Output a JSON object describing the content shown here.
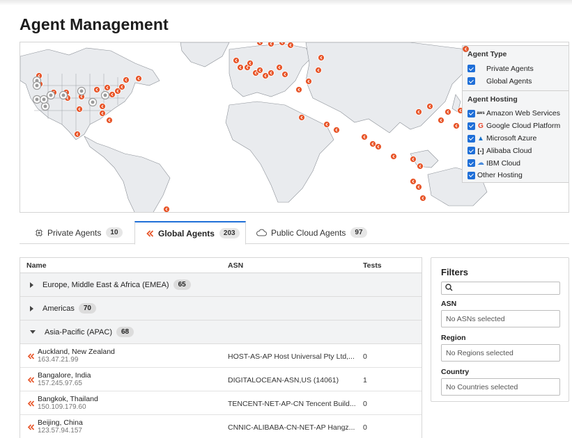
{
  "page": {
    "title": "Agent Management"
  },
  "legend": {
    "agent_type_title": "Agent Type",
    "agent_types": [
      {
        "label": "Private Agents",
        "icon": "private-agent-icon",
        "checked": true
      },
      {
        "label": "Global Agents",
        "icon": "global-agent-icon",
        "checked": true
      }
    ],
    "agent_hosting_title": "Agent Hosting",
    "hosting": [
      {
        "label": "Amazon Web Services",
        "icon": "aws-icon",
        "checked": true
      },
      {
        "label": "Google Cloud Platform",
        "icon": "google-icon",
        "checked": true
      },
      {
        "label": "Microsoft Azure",
        "icon": "azure-icon",
        "checked": true
      },
      {
        "label": "Alibaba Cloud",
        "icon": "alibaba-icon",
        "checked": true
      },
      {
        "label": "IBM Cloud",
        "icon": "ibm-cloud-icon",
        "checked": true
      },
      {
        "label": "Other Hosting",
        "icon": "",
        "checked": true
      }
    ]
  },
  "tabs": [
    {
      "label": "Private Agents",
      "count": "10",
      "active": false
    },
    {
      "label": "Global Agents",
      "count": "203",
      "active": true
    },
    {
      "label": "Public Cloud Agents",
      "count": "97",
      "active": false
    }
  ],
  "table": {
    "headers": {
      "name": "Name",
      "asn": "ASN",
      "tests": "Tests"
    },
    "groups": [
      {
        "label": "Europe, Middle East & Africa (EMEA)",
        "count": "65",
        "expanded": false
      },
      {
        "label": "Americas",
        "count": "70",
        "expanded": false
      },
      {
        "label": "Asia-Pacific (APAC)",
        "count": "68",
        "expanded": true
      }
    ],
    "rows": [
      {
        "city": "Auckland, New Zealand",
        "ip": "163.47.21.99",
        "asn": "HOST-AS-AP Host Universal Pty Ltd,...",
        "tests": "0"
      },
      {
        "city": "Bangalore, India",
        "ip": "157.245.97.65",
        "asn": "DIGITALOCEAN-ASN,US (14061)",
        "tests": "1"
      },
      {
        "city": "Bangkok, Thailand",
        "ip": "150.109.179.60",
        "asn": "TENCENT-NET-AP-CN Tencent Build...",
        "tests": "0"
      },
      {
        "city": "Beijing, China",
        "ip": "123.57.94.157",
        "asn": "CNNIC-ALIBABA-CN-NET-AP Hangz...",
        "tests": "0"
      }
    ]
  },
  "filters": {
    "title": "Filters",
    "search_placeholder": "",
    "asn_label": "ASN",
    "asn_value": "No ASNs selected",
    "region_label": "Region",
    "region_value": "No Regions selected",
    "country_label": "Country",
    "country_value": "No Countries selected"
  },
  "colors": {
    "accent": "#1f6fd8",
    "agent_orange": "#e8562a",
    "private_gray": "#9a9a9a"
  }
}
